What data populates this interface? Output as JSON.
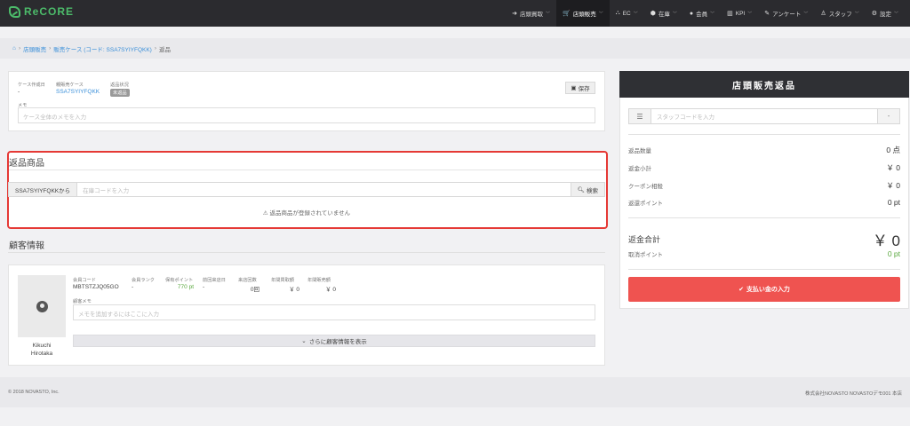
{
  "brand": {
    "name": "ReCORE",
    "color": "#4cbb6a"
  },
  "nav": [
    {
      "label": "店頭買取",
      "icon": "sign-in-icon",
      "glyph": "➜"
    },
    {
      "label": "店頭販売",
      "icon": "cart-icon",
      "glyph": "🛒",
      "active": true
    },
    {
      "label": "EC",
      "icon": "sitemap-icon",
      "glyph": "⛬"
    },
    {
      "label": "在庫",
      "icon": "cubes-icon",
      "glyph": "⬢"
    },
    {
      "label": "会員",
      "icon": "user-icon",
      "glyph": "●"
    },
    {
      "label": "KPI",
      "icon": "bar-chart-icon",
      "glyph": "▥"
    },
    {
      "label": "アンケート",
      "icon": "edit-icon",
      "glyph": "✎"
    },
    {
      "label": "スタッフ",
      "icon": "user-outline-icon",
      "glyph": "♙"
    },
    {
      "label": "設定",
      "icon": "gear-icon",
      "glyph": "⚙"
    }
  ],
  "breadcrumb": {
    "home_icon": "home-icon",
    "items": [
      "店頭販売",
      "販売ケース (コード: SSA7SYIYFQKK)"
    ],
    "current": "返品"
  },
  "case_info": {
    "created_label": "ケース作成日",
    "created_value": "-",
    "sales_case_label": "親販売ケース",
    "sales_case_value": "SSA7SYIYFQKK",
    "status_label": "返品状況",
    "status_value": "未返品",
    "save_label": "保存",
    "memo_label": "メモ",
    "memo_placeholder": "ケース全体のメモを入力"
  },
  "return_items": {
    "title": "返品商品",
    "from_label": "SSA7SYIYFQKKから",
    "input_placeholder": "在庫コードを入力",
    "search_label": "検索",
    "empty_message": "返品商品が登録されていません"
  },
  "customer": {
    "title": "顧客情報",
    "name_line1": "Kikuchi",
    "name_line2": "Hirotaka",
    "stats": [
      {
        "label": "会員コード",
        "value": "MBTSTZJQ05GO"
      },
      {
        "label": "会員ランク",
        "value": "-"
      },
      {
        "label": "保有ポイント",
        "value": "770 pt"
      },
      {
        "label": "前回来店日",
        "value": "-"
      },
      {
        "label": "来店回数",
        "value": "0回"
      },
      {
        "label": "年間買取額",
        "value": "￥ 0"
      },
      {
        "label": "年間販売額",
        "value": "￥ 0"
      }
    ],
    "memo_label": "顧客メモ",
    "memo_placeholder": "メモを追加するにはここに入力",
    "more_label": "さらに顧客情報を表示"
  },
  "summary": {
    "title": "店頭販売返品",
    "staff_placeholder": "スタッフコードを入力",
    "rows": [
      {
        "label": "返品数量",
        "value": "0 点"
      },
      {
        "label": "返金小計",
        "value": "￥ 0"
      },
      {
        "label": "クーポン相殺",
        "value": "￥ 0"
      },
      {
        "label": "返還ポイント",
        "value": "0 pt"
      }
    ],
    "total_label": "返金合計",
    "total_value": "￥ 0",
    "cancel_point_label": "取消ポイント",
    "cancel_point_value": "0 pt",
    "pay_label": "支払い金の入力"
  },
  "footer": {
    "copyright": "© 2018 NOVASTO, Inc.",
    "store": "株式会社NOVASTO NOVASTOデモ001 本店"
  },
  "colors": {
    "accent_red": "#ef5350",
    "highlight_border": "#e53935",
    "link_blue": "#3a8fd9",
    "point_green": "#5aa83f"
  }
}
